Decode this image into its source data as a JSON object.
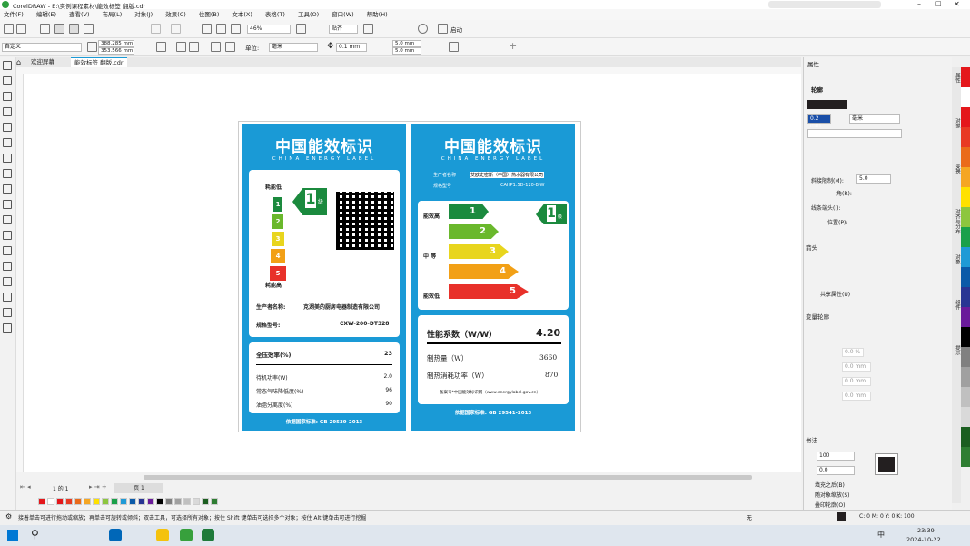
{
  "window": {
    "title": "CorelDRAW - E:\\实例课程素材\\能效标签 翻版.cdr"
  },
  "menu": [
    "文件(F)",
    "编辑(E)",
    "查看(V)",
    "布局(L)",
    "对象(J)",
    "效果(C)",
    "位图(B)",
    "文本(X)",
    "表格(T)",
    "工具(O)",
    "窗口(W)",
    "帮助(H)"
  ],
  "toolbar": {
    "zoom": "46%",
    "snap": "贴齐",
    "launch": "启动"
  },
  "propbar": {
    "preset": "自定义",
    "width": "388.285 mm",
    "height": "353.566 mm",
    "units_label": "单位:",
    "units": "毫米",
    "nudge": "0.1 mm",
    "dup_x": "5.0 mm",
    "dup_y": "5.0 mm"
  },
  "tabs": {
    "welcome": "欢迎屏幕",
    "doc": "能效标签 翻版.cdr"
  },
  "label_left": {
    "title": "中国能效标识",
    "subtitle": "CHINA ENERGY LABEL",
    "low": "耗能低",
    "high": "耗能高",
    "grade": "1",
    "grade_unit": "级",
    "levels": [
      "1",
      "2",
      "3",
      "4",
      "5"
    ],
    "maker_label": "生产者名称:",
    "maker": "克湖美的厨房电器制造有限公司",
    "model_label": "规格型号:",
    "model": "CXW-200-DT328",
    "rows": [
      {
        "k": "全压效率(%)",
        "v": "23"
      },
      {
        "k": "待机功率(W)",
        "v": "2.0"
      },
      {
        "k": "常态气味降低度(%)",
        "v": "96"
      },
      {
        "k": "油脂分离度(%)",
        "v": "90"
      }
    ],
    "standard": "依据国家标准: GB 29539-2013"
  },
  "label_right": {
    "title": "中国能效标识",
    "subtitle": "CHINA ENERGY LABEL",
    "maker_label": "生产者名称",
    "maker": "艾欧史密斯（中国）热水器有限公司",
    "model_label": "规格型号",
    "model": "CAHP1.5D-120-B-W",
    "low": "能效高",
    "mid": "中 等",
    "high": "能效低",
    "grade": "1",
    "grade_unit": "级",
    "levels": [
      "1",
      "2",
      "3",
      "4",
      "5"
    ],
    "perf_label": "性能系数（W/W）",
    "perf_value": "4.20",
    "heat_label": "制热量（W）",
    "heat_value": "3660",
    "power_label": "制热消耗功率（W）",
    "power_value": "870",
    "note": "备案号*中国能效标识网（www.energylabel.gov.cn）",
    "standard": "依据国家标准: GB 29541-2013"
  },
  "page_nav": {
    "current": "1 的 1",
    "page": "页 1"
  },
  "properties": {
    "title": "属性",
    "outline": "轮廓",
    "width": "0.2 mm",
    "unit": "毫米",
    "miter_label": "斜接限制(M):",
    "miter": "5.0",
    "corner_label": "角(R):",
    "cap_label": "线条端头(I):",
    "pos_label": "位置(P):",
    "arrow_label": "箭头",
    "share_label": "共享属性(U)",
    "calligraphy_label": "变量轮廓",
    "angle_pct": "0.0 %",
    "mm1": "0.0 mm",
    "mm2": "0.0 mm",
    "mm3": "0.0 mm",
    "pen_label": "书法",
    "pen_width": "100",
    "pen_angle": "0.0",
    "fill_after": "填充之后(B)",
    "scale_stroke": "随对象缩放(S)",
    "overprint": "叠印轮廓(O)"
  },
  "vtabs": [
    "属性",
    "对象",
    "变换",
    "对齐与分布",
    "对象",
    "组件",
    "提示"
  ],
  "status": {
    "hint": "接着单击可进行拖动或缩放；再单击可旋转或倾斜；双击工具，可选择所有对象；按住 Shift 键单击可选择多个对象；按住 Alt 键单击可进行挖掘",
    "fill": "无",
    "cmyk": "C: 0 M: 0 Y: 0 K: 100"
  },
  "taskbar": {
    "time": "23:39",
    "date": "2024-10-22",
    "ime": "中"
  },
  "colors": {
    "blue": "#1a9ad6",
    "g1": "#1b8a3e",
    "g2": "#6ab82c",
    "g3": "#e8d51e",
    "g4": "#f2a016",
    "g5": "#e8312a"
  },
  "palette": [
    "#e4171b",
    "#ffffff",
    "#e4171b",
    "#e83a24",
    "#ea6b1b",
    "#f5a623",
    "#ffe100",
    "#8dc63f",
    "#1aa04a",
    "#1f9ad6",
    "#0b5aa8",
    "#283593",
    "#6a1b9a",
    "#000000",
    "#808080",
    "#a0a0a0",
    "#c0c0c0",
    "#d9d9d9",
    "#1b5e20",
    "#2e7d32"
  ]
}
